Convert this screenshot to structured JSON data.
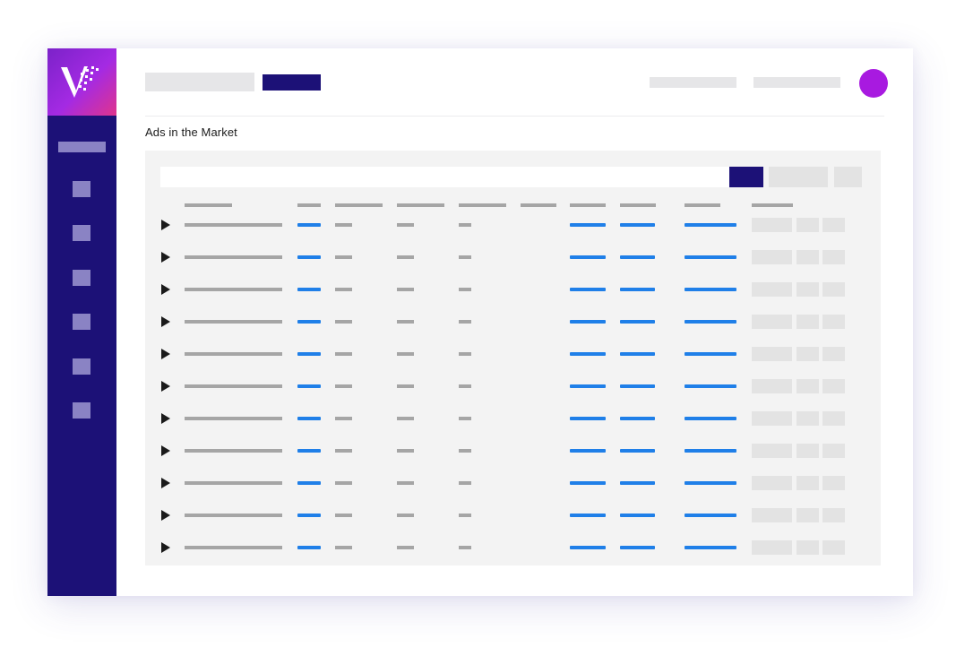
{
  "page": {
    "title": "Ads in the Market"
  },
  "header": {
    "primary_button": "",
    "avatar": "user-avatar"
  },
  "sidebar": {
    "items": [
      "nav-item",
      "nav-item",
      "nav-item",
      "nav-item",
      "nav-item",
      "nav-item"
    ]
  },
  "search": {
    "value": "",
    "placeholder": ""
  },
  "table": {
    "row_count": 11,
    "row_icon": "play-icon"
  },
  "colors": {
    "sidebar": "#1c1177",
    "accent": "#1c1177",
    "link_placeholder": "#1f7fe8",
    "avatar": "#a81ae0",
    "logo_gradient": [
      "#7b22c9",
      "#a42ae3",
      "#e0348c"
    ]
  }
}
